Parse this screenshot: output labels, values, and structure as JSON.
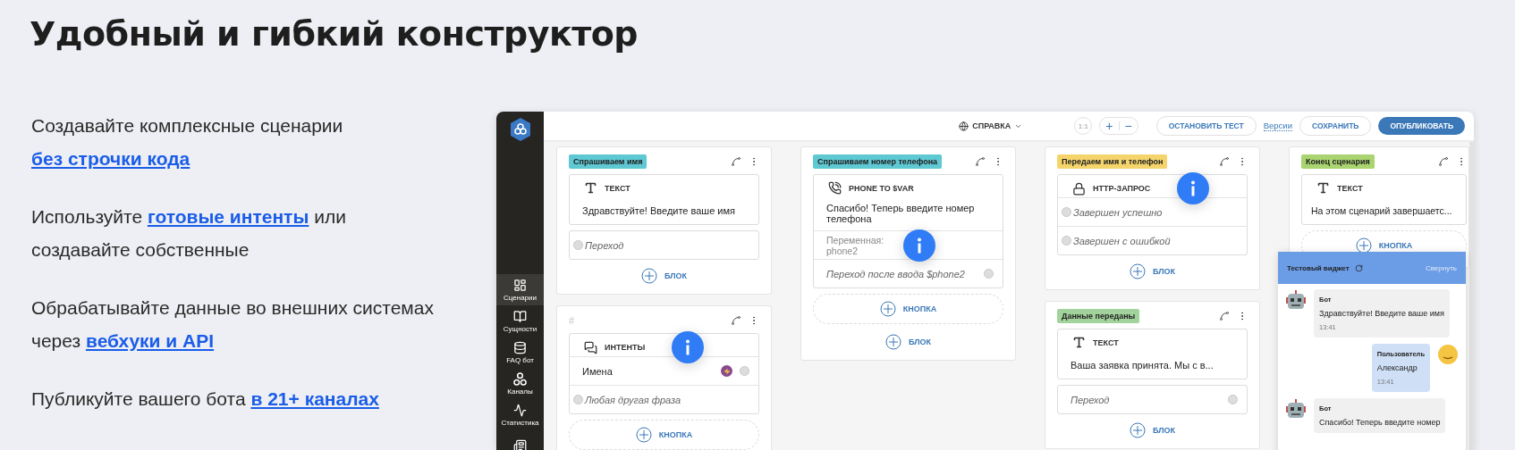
{
  "heading": "Удобный и гибкий конструктор",
  "features": [
    {
      "before": "Создавайте комплексные сценарии",
      "link": "без строчки кода"
    },
    {
      "before": "Используйте",
      "link": "готовые интенты",
      "after": "или создавайте собственные"
    },
    {
      "before": "Обрабатывайте данные во внешних системах через",
      "link": "вебхуки и API"
    },
    {
      "before": "Публикуйте вашего бота",
      "link": "в 21+ каналах"
    }
  ],
  "app": {
    "sidebar": [
      {
        "kind": "grid",
        "label": "Сценарии",
        "selected": true
      },
      {
        "kind": "book",
        "label": "Сущности",
        "selected": false
      },
      {
        "kind": "database",
        "label": "FAQ бот",
        "selected": false
      },
      {
        "kind": "nodes",
        "label": "Каналы",
        "selected": false
      },
      {
        "kind": "chart",
        "label": "Статистика",
        "selected": false
      },
      {
        "kind": "list",
        "selected": false
      }
    ],
    "toolbar": {
      "help": "СПРАВКА",
      "zoom_reset": {
        "label": "1:1",
        "disabled": true
      },
      "zoom_in": "+",
      "zoom_out": "−",
      "stop_test": "ОСТАНОВИТЬ ТЕСТ",
      "versions": "Версии",
      "save": "СОХРАНИТЬ",
      "publish": "ОПУБЛИКОВАТЬ"
    },
    "columns": [
      [
        {
          "tag": "Спрашиваем имя",
          "color": "#5ec8d3",
          "blocks": [
            {
              "header": {
                "kind": "text",
                "title": "ТЕКСТ"
              },
              "rows": [
                {
                  "kind": "message",
                  "text": "Здравствуйте! Введите ваше имя"
                }
              ]
            },
            {
              "rows": [
                {
                  "kind": "branch",
                  "text": "Переход"
                }
              ]
            }
          ],
          "footer": [
            {
              "kind": "plain",
              "label": "БЛОК"
            }
          ]
        },
        {
          "tag": "#",
          "blocks": [
            {
              "header": {
                "kind": "intents",
                "title": "ИНТЕНТЫ",
                "hint": true
              },
              "rows": [
                {
                  "kind": "intent",
                  "text": "Имена"
                },
                {
                  "kind": "branch",
                  "text": "Любая другая фраза"
                }
              ]
            }
          ],
          "footer": [
            {
              "kind": "dashed",
              "label": "КНОПКА"
            }
          ]
        }
      ],
      [
        {
          "tag": "Спрашиваем номер телефона",
          "color": "#5ec8d3",
          "blocks": [
            {
              "header": {
                "kind": "phone",
                "title": "PHONE TO $VAR"
              },
              "rows": [
                {
                  "kind": "message",
                  "text": "Спасибо! Теперь введите номер телефона"
                },
                {
                  "kind": "variable",
                  "label": "Переменная:",
                  "text": "phone2",
                  "hint": true
                },
                {
                  "kind": "exit",
                  "text": "Переход после ввода $phone2"
                }
              ]
            }
          ],
          "footer": [
            {
              "kind": "dashed",
              "label": "КНОПКА"
            },
            {
              "kind": "plain",
              "label": "БЛОК"
            }
          ]
        }
      ],
      [
        {
          "tag": "Передаем имя и телефон",
          "color": "#f5d56b",
          "blocks": [
            {
              "header": {
                "kind": "lock",
                "title": "HTTP-ЗАПРОС",
                "hint": true
              },
              "rows": [
                {
                  "kind": "branch",
                  "text": "Завершен успешно"
                },
                {
                  "kind": "branch",
                  "text": "Завершен с ошибкой"
                }
              ]
            }
          ],
          "footer": [
            {
              "kind": "plain",
              "label": "БЛОК"
            }
          ]
        },
        {
          "tag": "Данные переданы",
          "color": "#a3d39c",
          "blocks": [
            {
              "header": {
                "kind": "text",
                "title": "ТЕКСТ"
              },
              "rows": [
                {
                  "kind": "message",
                  "text": "Ваша заявка принята. Мы с в..."
                }
              ]
            },
            {
              "rows": [
                {
                  "kind": "exit",
                  "text": "Переход"
                }
              ]
            }
          ],
          "footer": [
            {
              "kind": "plain",
              "label": "БЛОК"
            }
          ]
        }
      ],
      [
        {
          "tag": "Конец сценария",
          "color": "#a9d46f",
          "blocks": [
            {
              "header": {
                "kind": "text",
                "title": "ТЕКСТ"
              },
              "rows": [
                {
                  "kind": "message",
                  "text": "На этом сценарий завершаетс..."
                }
              ]
            }
          ],
          "footer": [
            {
              "kind": "dashed",
              "label": "КНОПКА"
            }
          ]
        }
      ]
    ],
    "widget": {
      "title": "Тестовый виджет",
      "collapse": "Свернуть",
      "messages": [
        {
          "kind": "bot",
          "author": "Бот",
          "text": "Здравствуйте! Введите ваше имя",
          "time": "13:41"
        },
        {
          "kind": "user",
          "author": "Пользователь",
          "text": "Александр",
          "time": "13:41"
        },
        {
          "kind": "bot",
          "author": "Бот",
          "text": "Спасибо! Теперь введите номер"
        }
      ]
    }
  }
}
